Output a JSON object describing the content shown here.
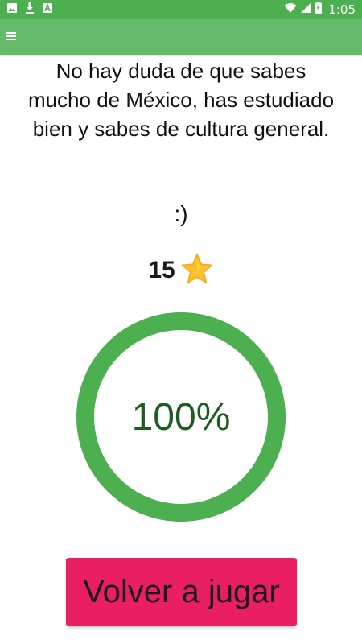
{
  "status_bar": {
    "time": "1:05",
    "background": "#4caf50",
    "left_icons": [
      "image-icon",
      "download-icon",
      "font-icon"
    ],
    "right_icons": [
      "wifi-icon",
      "signal-icon",
      "battery-icon"
    ]
  },
  "app_bar": {
    "background": "#66bb6a",
    "menu_icon": "menu-icon"
  },
  "result": {
    "message": "No hay duda de que sabes mucho de México, has estudiado bien y sabes de cultura general.",
    "emoticon": ":)",
    "score": "15",
    "score_icon": "star-icon",
    "progress_value": 1.0,
    "progress_label": "100%",
    "progress_color": "#4caf50"
  },
  "actions": {
    "replay_label": "Volver a jugar",
    "replay_color": "#e91e63"
  }
}
